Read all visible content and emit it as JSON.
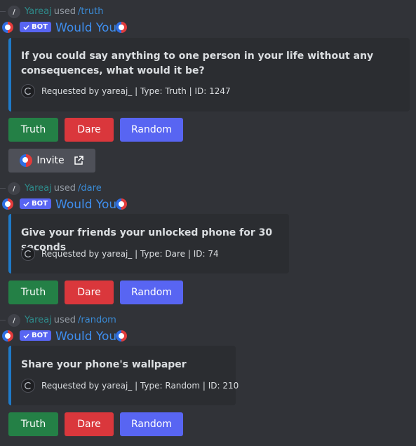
{
  "bot": {
    "name": "Would You",
    "tag": "BOT",
    "logo_icon": "would-you-logo-icon"
  },
  "colors": {
    "background": "#313338",
    "embed_bg": "#2b2d31",
    "embed_accent": "#1f7ac8",
    "truth": "#248046",
    "dare": "#da373c",
    "random": "#5865f2",
    "invite": "#4e5058",
    "bot_name": "#3f8ff0",
    "username": "#2e8b8b",
    "command": "#3a8bd6"
  },
  "messages": [
    {
      "user": "Yareaj",
      "used": "used",
      "command": "/truth",
      "question": "If you could say anything to one person in your life without any consequences, what would it be?",
      "footer": "Requested by yareaj_ | Type: Truth | ID: 1247"
    },
    {
      "user": "Yareaj",
      "used": "used",
      "command": "/dare",
      "question": "Give your friends your unlocked phone for 30 seconds",
      "footer": "Requested by yareaj_ | Type: Dare | ID: 74"
    },
    {
      "user": "Yareaj",
      "used": "used",
      "command": "/random",
      "question": "Share your phone's wallpaper",
      "footer": "Requested by yareaj_ | Type: Random | ID: 210"
    }
  ],
  "buttons": {
    "truth": "Truth",
    "dare": "Dare",
    "random": "Random",
    "invite": "Invite"
  }
}
